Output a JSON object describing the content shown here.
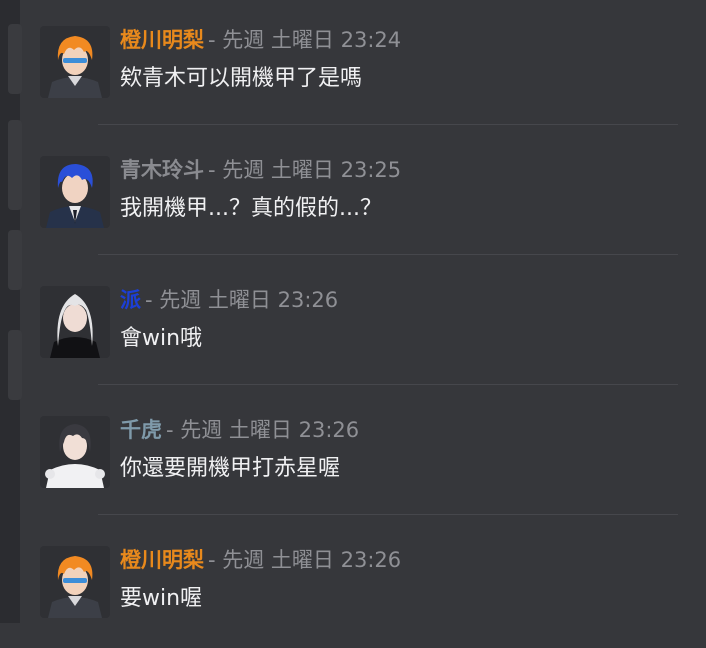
{
  "colors": {
    "background": "#36373b",
    "timestamp": "#8f9095",
    "message_text": "#f0f0f2"
  },
  "messages": [
    {
      "author": "橙川明梨",
      "author_color": "#e8891c",
      "timestamp": "- 先週 土曜日 23:24",
      "text": "欸青木可以開機甲了是嗎",
      "avatar_icon": "orange-hair-character-avatar"
    },
    {
      "author": "青木玲斗",
      "author_color": "#8a8b90",
      "timestamp": "- 先週 土曜日 23:25",
      "text": "我開機甲...？真的假的...？",
      "avatar_icon": "blue-hair-character-avatar"
    },
    {
      "author": "派",
      "author_color": "#1c3fd6",
      "timestamp": "- 先週 土曜日 23:26",
      "text": "會win哦",
      "avatar_icon": "silver-hair-character-avatar"
    },
    {
      "author": "千虎",
      "author_color": "#7f9aaa",
      "timestamp": "- 先週 土曜日 23:26",
      "text": "你還要開機甲打赤星喔",
      "avatar_icon": "dark-hair-character-avatar"
    },
    {
      "author": "橙川明梨",
      "author_color": "#e8891c",
      "timestamp": "- 先週 土曜日 23:26",
      "text": "要win喔",
      "avatar_icon": "orange-hair-character-avatar"
    }
  ]
}
